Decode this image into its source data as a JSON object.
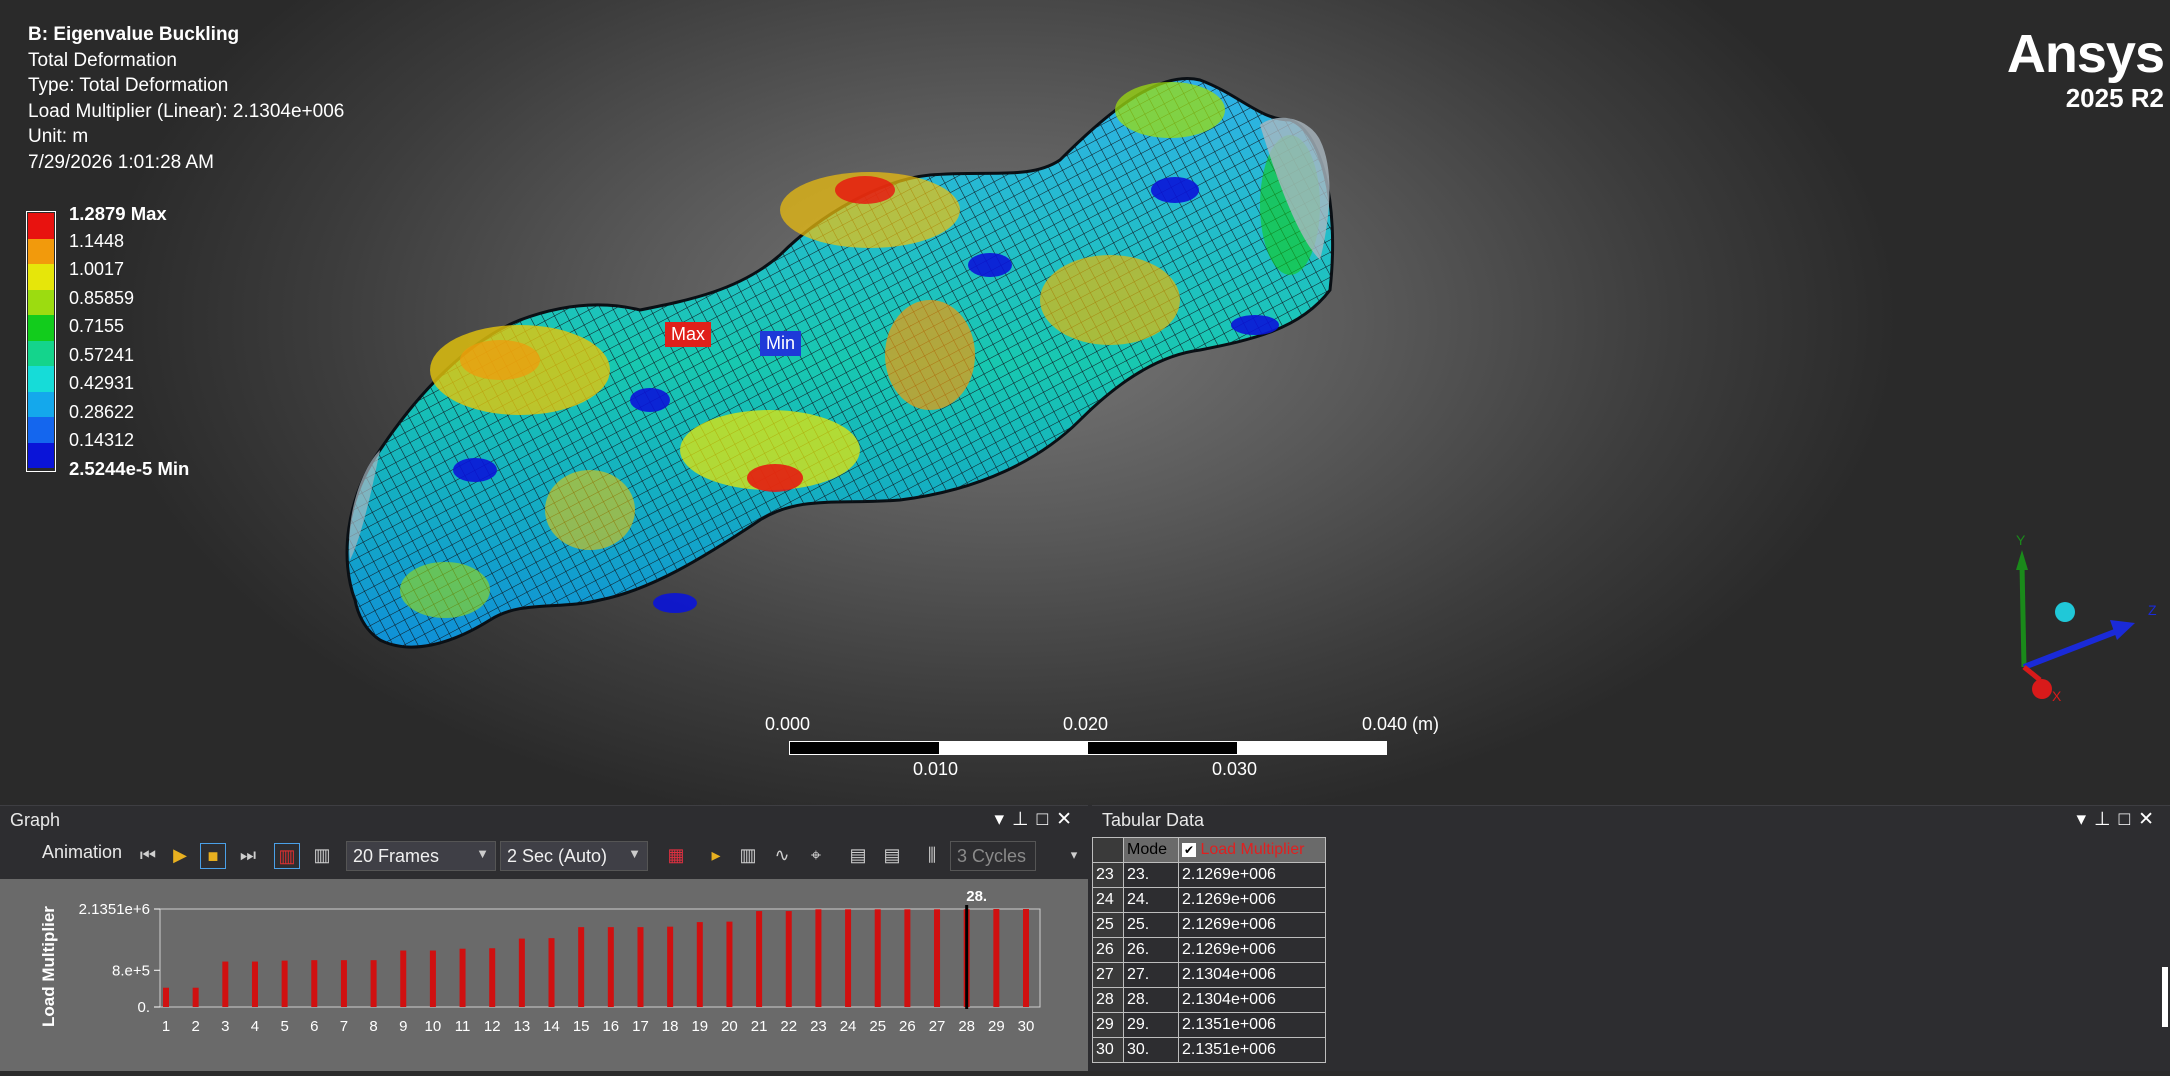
{
  "info": {
    "title": "B: Eigenvalue Buckling",
    "line1": "Total Deformation",
    "line2": "Type: Total Deformation",
    "line3": "Load Multiplier (Linear): 2.1304e+006",
    "line4": "Unit: m",
    "line5": "7/29/2026 1:01:28 AM"
  },
  "legend": {
    "levels": [
      {
        "label": "1.2879 Max",
        "color": "#e8120f"
      },
      {
        "label": "1.1448",
        "color": "#f29a0c"
      },
      {
        "label": "1.0017",
        "color": "#e6e60a"
      },
      {
        "label": "0.85859",
        "color": "#9cdc10"
      },
      {
        "label": "0.7155",
        "color": "#12cc1c"
      },
      {
        "label": "0.57241",
        "color": "#14d48c"
      },
      {
        "label": "0.42931",
        "color": "#16dcd8"
      },
      {
        "label": "0.28622",
        "color": "#14a8ec"
      },
      {
        "label": "0.14312",
        "color": "#1466ee"
      },
      {
        "label": "2.5244e-5 Min",
        "color": "#0a14d8"
      }
    ]
  },
  "logo": {
    "brand": "Ansys",
    "version": "2025 R2"
  },
  "probes": {
    "max": "Max",
    "min": "Min"
  },
  "scale_bar": {
    "top_labels": [
      "0.000",
      "0.020",
      "0.040 (m)"
    ],
    "bottom_labels": [
      "0.010",
      "0.030"
    ]
  },
  "triad": {
    "x": "X",
    "y": "Y",
    "z": "Z"
  },
  "graph_panel": {
    "title": "Graph",
    "animation_label": "Animation",
    "frames": "20 Frames",
    "duration": "2 Sec (Auto)",
    "cycles": "3 Cycles"
  },
  "tabular_panel": {
    "title": "Tabular Data",
    "col_mode": "Mode",
    "col_load": "Load Multiplier",
    "rows": [
      {
        "n": "23",
        "mode": "23.",
        "value": "2.1269e+006"
      },
      {
        "n": "24",
        "mode": "24.",
        "value": "2.1269e+006"
      },
      {
        "n": "25",
        "mode": "25.",
        "value": "2.1269e+006"
      },
      {
        "n": "26",
        "mode": "26.",
        "value": "2.1269e+006"
      },
      {
        "n": "27",
        "mode": "27.",
        "value": "2.1304e+006"
      },
      {
        "n": "28",
        "mode": "28.",
        "value": "2.1304e+006"
      },
      {
        "n": "29",
        "mode": "29.",
        "value": "2.1351e+006"
      },
      {
        "n": "30",
        "mode": "30.",
        "value": "2.1351e+006"
      }
    ]
  },
  "chart_data": {
    "type": "bar",
    "ylabel": "Load Multiplier",
    "ytick_labels": [
      "2.1351e+6",
      "8.e+5",
      "0."
    ],
    "yticks": [
      2135100,
      800000,
      0
    ],
    "ylim": [
      0,
      2135100
    ],
    "categories": [
      "1",
      "2",
      "3",
      "4",
      "5",
      "6",
      "7",
      "8",
      "9",
      "10",
      "11",
      "12",
      "13",
      "14",
      "15",
      "16",
      "17",
      "18",
      "19",
      "20",
      "21",
      "22",
      "23",
      "24",
      "25",
      "26",
      "27",
      "28",
      "29",
      "30"
    ],
    "values": [
      420000,
      420000,
      990000,
      990000,
      1010000,
      1020000,
      1020000,
      1020000,
      1230000,
      1230000,
      1270000,
      1280000,
      1490000,
      1500000,
      1740000,
      1740000,
      1740000,
      1750000,
      1850000,
      1860000,
      2090000,
      2090000,
      2130000,
      2130000,
      2130000,
      2130000,
      2130400,
      2130400,
      2135100,
      2135100
    ],
    "highlight_label": "28.",
    "bar_color": "#d01010"
  }
}
